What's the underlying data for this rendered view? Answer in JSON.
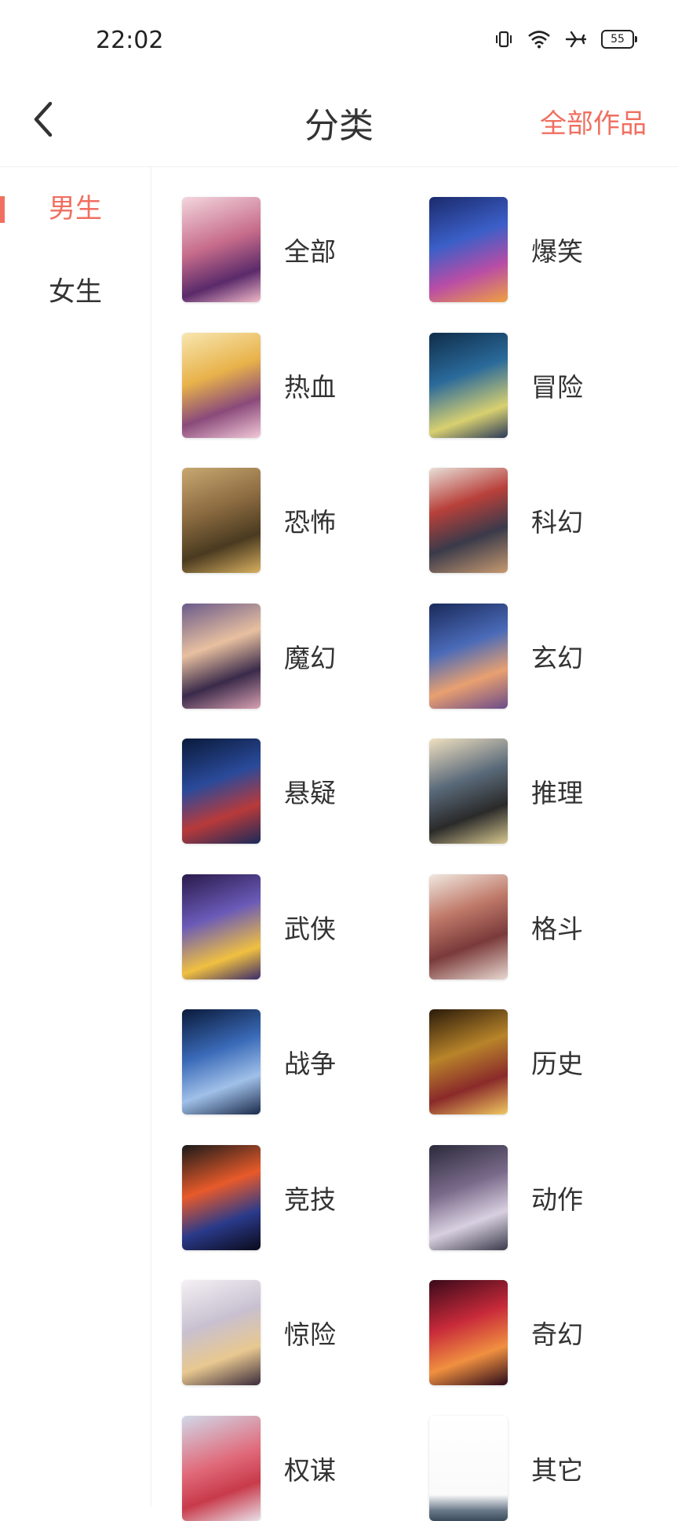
{
  "status_bar": {
    "time": "22:02",
    "battery": "55",
    "icons": [
      "vibrate-icon",
      "wifi-icon",
      "airplane-icon",
      "battery-icon"
    ]
  },
  "header": {
    "back_icon": "chevron-left-icon",
    "title": "分类",
    "right_link": "全部作品"
  },
  "colors": {
    "accent": "#f06f60",
    "text": "#333333",
    "divider": "#eeeeee"
  },
  "sidebar": {
    "items": [
      {
        "label": "男生",
        "active": true
      },
      {
        "label": "女生",
        "active": false
      }
    ]
  },
  "categories": [
    {
      "label": "全部",
      "thumb": "linear-gradient(160deg,#f3d6de 0%,#c66b8a 45%,#5a2a6a 75%,#f0b8c8 100%)"
    },
    {
      "label": "爆笑",
      "thumb": "linear-gradient(160deg,#1b2a6b 0%,#3b5fc8 40%,#b84da6 70%,#f0a040 100%)"
    },
    {
      "label": "热血",
      "thumb": "linear-gradient(160deg,#f7e6b0 0%,#e8b24a 40%,#8a4a7a 70%,#f2c8d8 100%)"
    },
    {
      "label": "冒险",
      "thumb": "linear-gradient(160deg,#0f2d4a 0%,#2a6a9a 40%,#d8d070 75%,#2a3a5a 100%)"
    },
    {
      "label": "恐怖",
      "thumb": "linear-gradient(160deg,#c8a870 0%,#8a6a40 40%,#4a3a20 70%,#d8b060 100%)"
    },
    {
      "label": "科幻",
      "thumb": "linear-gradient(160deg,#e8e0d8 0%,#b8403a 35%,#3a3a4a 65%,#c89a70 100%)"
    },
    {
      "label": "魔幻",
      "thumb": "linear-gradient(160deg,#6a5a8a 0%,#e8c0a0 40%,#3a2a4a 70%,#d8a0b0 100%)"
    },
    {
      "label": "玄幻",
      "thumb": "linear-gradient(160deg,#1a2a5a 0%,#4a6ab8 40%,#e8a070 70%,#6a4a8a 100%)"
    },
    {
      "label": "悬疑",
      "thumb": "linear-gradient(160deg,#0a1a3a 0%,#2a4a9a 40%,#b83a3a 70%,#1a2a5a 100%)"
    },
    {
      "label": "推理",
      "thumb": "linear-gradient(160deg,#f0e0c0 0%,#5a6a7a 40%,#2a2a2a 70%,#d8c890 100%)"
    },
    {
      "label": "武侠",
      "thumb": "linear-gradient(160deg,#2a1a4a 0%,#6a5ab8 40%,#f0c040 75%,#3a2a6a 100%)"
    },
    {
      "label": "格斗",
      "thumb": "linear-gradient(160deg,#f0e8e0 0%,#c07a6a 35%,#7a3a3a 65%,#e8d8d0 100%)"
    },
    {
      "label": "战争",
      "thumb": "linear-gradient(160deg,#0a1a3a 0%,#3a6ab8 40%,#a0c0e8 70%,#1a2a4a 100%)"
    },
    {
      "label": "历史",
      "thumb": "linear-gradient(160deg,#2a1a0a 0%,#b8842a 40%,#8a2a2a 70%,#f0c860 100%)"
    },
    {
      "label": "竞技",
      "thumb": "linear-gradient(160deg,#1a1a1a 0%,#e85a2a 40%,#2a3a8a 70%,#0a0a1a 100%)"
    },
    {
      "label": "动作",
      "thumb": "linear-gradient(160deg,#2a2a3a 0%,#7a6a8a 40%,#d8d0e0 70%,#3a3a4a 100%)"
    },
    {
      "label": "惊险",
      "thumb": "linear-gradient(160deg,#f4f0f4 0%,#c8c0d0 40%,#e8c890 70%,#3a2a3a 100%)"
    },
    {
      "label": "奇幻",
      "thumb": "linear-gradient(160deg,#3a0a1a 0%,#c82a3a 40%,#f09040 70%,#2a0a1a 100%)"
    },
    {
      "label": "权谋",
      "thumb": "linear-gradient(160deg,#d0d8e8 0%,#e06a7a 45%,#c83a4a 70%,#e8e0e8 100%)"
    },
    {
      "label": "其它",
      "thumb": "linear-gradient(180deg,#ffffff 0%,#fafafa 75%,#6a7a8a 90%,#3a4a5a 100%)"
    }
  ]
}
